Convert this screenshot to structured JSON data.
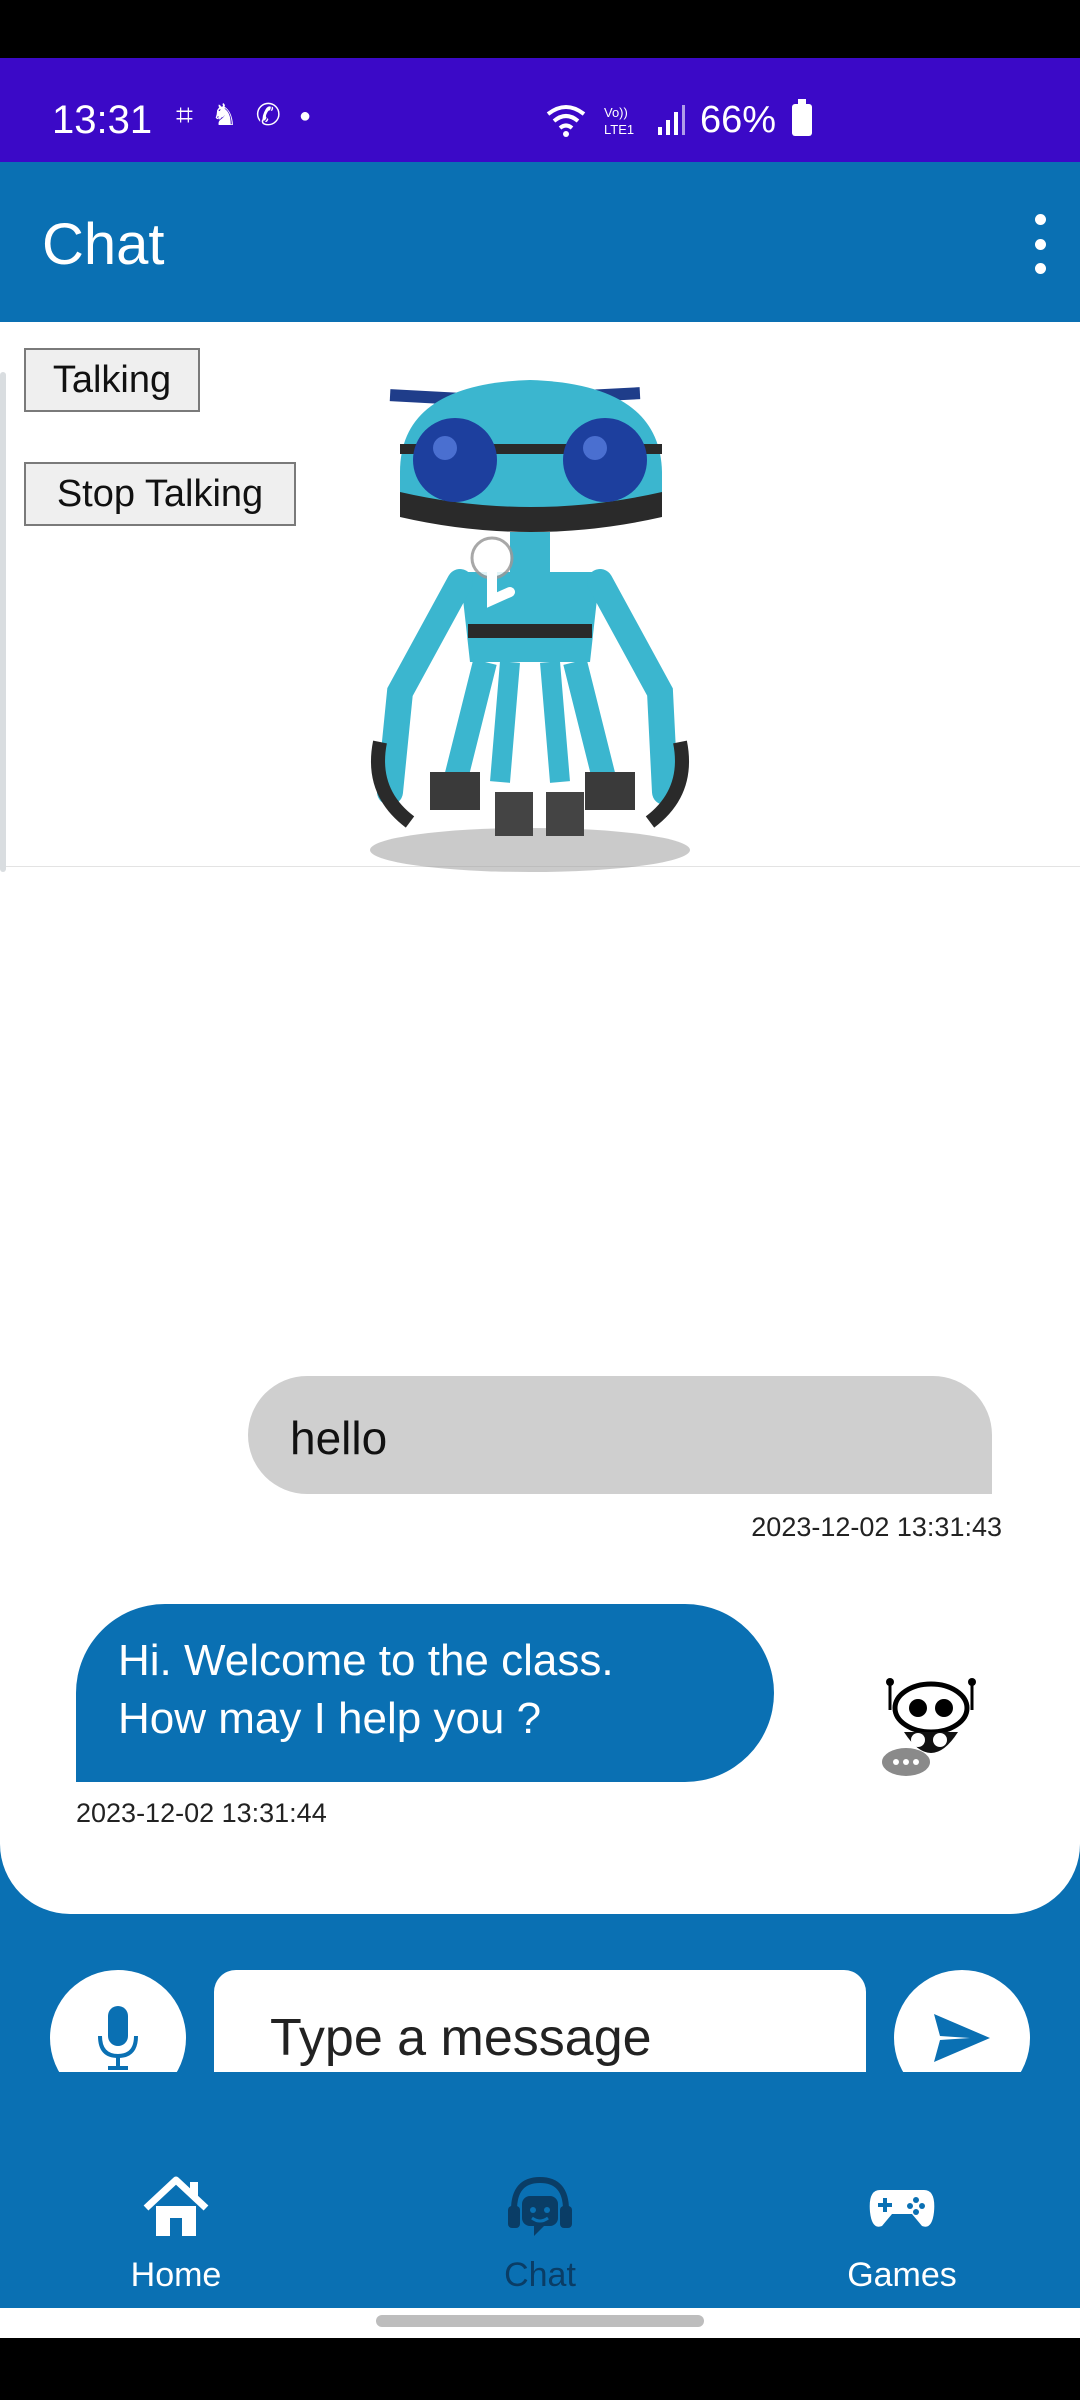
{
  "status_bar": {
    "time": "13:31",
    "battery": "66%",
    "icons": [
      "screenshot-icon",
      "notification-icon",
      "phone-icon",
      "dot-icon",
      "wifi-icon",
      "volte-icon",
      "signal-icon",
      "battery-icon"
    ]
  },
  "app_bar": {
    "title": "Chat",
    "menu_icon": "more-vertical-icon"
  },
  "robot_view": {
    "buttons": {
      "talking": "Talking",
      "stop_talking": "Stop Talking"
    }
  },
  "messages": [
    {
      "sender": "user",
      "text": "hello",
      "timestamp": "2023-12-02 13:31:43"
    },
    {
      "sender": "bot",
      "text": "Hi. Welcome to the class.\nHow may I help you ?",
      "timestamp": "2023-12-02 13:31:44"
    }
  ],
  "composer": {
    "placeholder": "Type a message",
    "value": ""
  },
  "bottom_nav": {
    "items": [
      {
        "label": "Home",
        "icon": "home-icon"
      },
      {
        "label": "Chat",
        "icon": "chat-headset-icon",
        "active": true
      },
      {
        "label": "Games",
        "icon": "gamepad-icon"
      }
    ]
  },
  "colors": {
    "status_bar": "#3b09c7",
    "primary": "#0a70b3",
    "user_bubble": "#cfcfcf",
    "active_nav_label": "#0a3d66"
  }
}
